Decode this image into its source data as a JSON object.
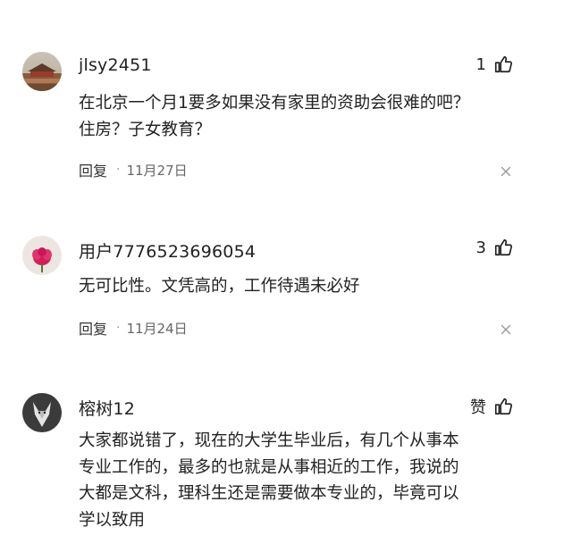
{
  "comments": [
    {
      "username": "jlsy2451",
      "likes": "1",
      "lines": [
        "在北京一个月1要多如果没有家里的资助会很难的吧？",
        "住房？子女教育？"
      ],
      "reply_label": "回复",
      "separator": "·",
      "date": "11月27日",
      "avatar_icon": "palace-photo-avatar"
    },
    {
      "username": "用户7776523696054",
      "likes": "3",
      "lines": [
        "无可比性。文凭高的，工作待遇未必好"
      ],
      "reply_label": "回复",
      "separator": "·",
      "date": "11月24日",
      "avatar_icon": "pink-flower-avatar"
    },
    {
      "username": "榕树12",
      "likes": "赞",
      "lines": [
        "大家都说错了，现在的大学生毕业后，有几个从事本",
        "专业工作的，最多的也就是从事相近的工作，我说的",
        "大都是文科，理科生还是需要做本专业的，毕竟可以",
        "学以致用"
      ],
      "avatar_icon": "wolf-photo-avatar"
    }
  ],
  "colors": {
    "text": "#222222",
    "meta": "#666666",
    "background": "#ffffff"
  }
}
